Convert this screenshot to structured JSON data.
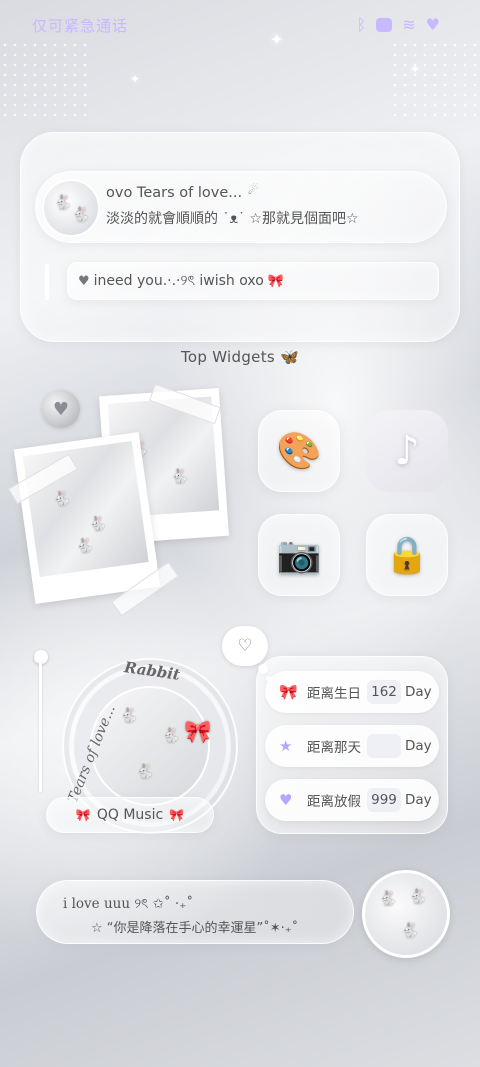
{
  "status_bar": {
    "carrier": "仅可紧急通话",
    "icons": [
      "bluetooth-icon",
      "battery-icon",
      "wifi-icon",
      "heart-icon"
    ]
  },
  "profile": {
    "name": "ovo Tears of love...",
    "name_deco": "☄",
    "quote": "淡淡的就會順順的 ˙ᴥ˙ ☆那就見個面吧☆",
    "message_prefix": "♥",
    "message": "ineed you.·.·୨ৎ iwish oxo",
    "message_suffix": "🎀"
  },
  "section_title": "Top Widgets 🦋",
  "apps": [
    {
      "name": "paint",
      "glyph": "🎨"
    },
    {
      "name": "tiktok",
      "glyph": "♪"
    },
    {
      "name": "camera",
      "glyph": "📷"
    },
    {
      "name": "heart-lock",
      "glyph": "🔒"
    }
  ],
  "music_widget": {
    "arc_top": "Rabbit",
    "arc_side": "Tears of love...",
    "label": "QQ Music",
    "bow": "🎀"
  },
  "countdowns": [
    {
      "icon": "🎀",
      "label": "距离生日",
      "value": "162",
      "unit": "Day"
    },
    {
      "icon": "★",
      "label": "距离那天",
      "value": "",
      "unit": "Day"
    },
    {
      "icon": "♥",
      "label": "距离放假",
      "value": "999",
      "unit": "Day"
    }
  ],
  "bottom_text": {
    "line1": "i love uuu ୨ৎ ✩˚ ‧₊˚",
    "line2": "☆ “你是降落在手心的幸運星”˚✶‧₊˚"
  },
  "colors": {
    "accent": "#c8b8ff",
    "text": "#555555",
    "glass_border": "#ffffff"
  }
}
